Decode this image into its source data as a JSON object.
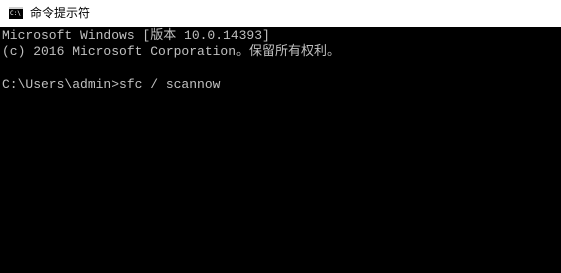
{
  "window": {
    "title": "命令提示符",
    "icon": "console-icon",
    "icon_text": "C:\\"
  },
  "console": {
    "lines": [
      "Microsoft Windows [版本 10.0.14393]",
      "(c) 2016 Microsoft Corporation。保留所有权利。",
      "C:\\Users\\admin>sfc / scannow"
    ]
  },
  "colors": {
    "console_background": "#000000",
    "console_text": "#c0c0c0",
    "titlebar_background": "#ffffff"
  }
}
